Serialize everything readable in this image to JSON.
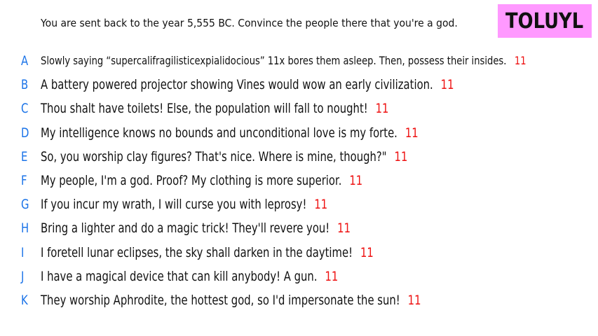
{
  "prompt": "You are sent back to the year 5,555 BC. Convince the people there that you're a god.",
  "badge": {
    "label": "TOLUYL",
    "background": "#ff99ff",
    "color": "#111111"
  },
  "colors": {
    "letter": "#1a73e8",
    "score": "#ee1111",
    "text": "#111111"
  },
  "answers": [
    {
      "letter": "A",
      "text": "Slowly saying “supercalifragilisticexpialidocious” 11x bores them asleep. Then, possess their insides.",
      "score": "11"
    },
    {
      "letter": "B",
      "text": "A battery powered projector showing Vines would wow an early civilization.",
      "score": "11"
    },
    {
      "letter": "C",
      "text": "Thou shalt have toilets! Else, the population will fall to nought!",
      "score": "11"
    },
    {
      "letter": "D",
      "text": "My intelligence knows no bounds and unconditional love is my forte.",
      "score": "11"
    },
    {
      "letter": "E",
      "text": "So, you worship clay figures? That's nice. Where is mine, though?\"",
      "score": "11"
    },
    {
      "letter": "F",
      "text": "My people, I'm a god. Proof? My clothing is more superior.",
      "score": "11"
    },
    {
      "letter": "G",
      "text": "If you incur my wrath, I will curse you with leprosy!",
      "score": "11"
    },
    {
      "letter": "H",
      "text": "Bring a lighter and do a magic trick! They'll revere you!",
      "score": "11"
    },
    {
      "letter": "I",
      "text": "I foretell lunar eclipses, the sky shall darken in the daytime!",
      "score": "11"
    },
    {
      "letter": "J",
      "text": "I have a magical device that can kill anybody! A gun.",
      "score": "11"
    },
    {
      "letter": "K",
      "text": "They worship Aphrodite, the hottest god, so I'd impersonate the sun!",
      "score": "11"
    }
  ]
}
